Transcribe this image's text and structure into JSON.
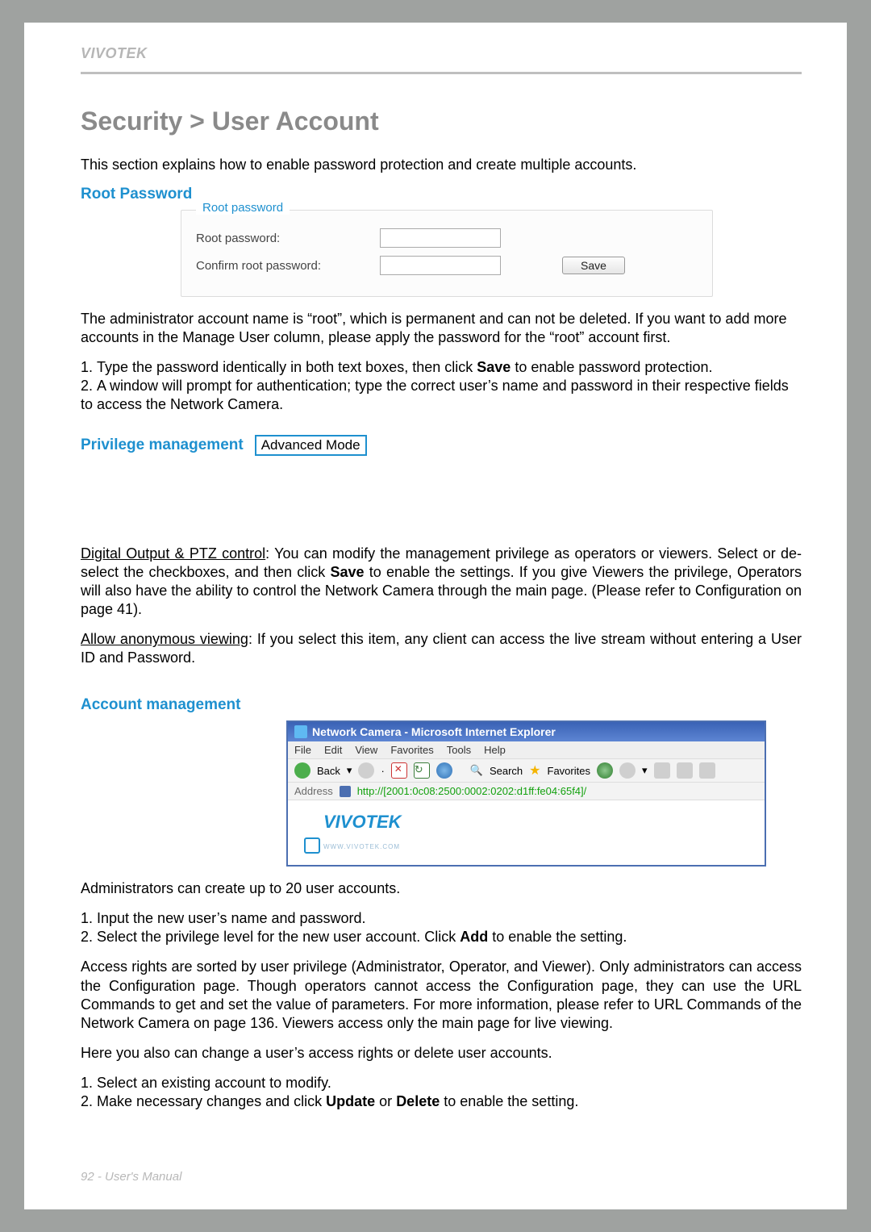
{
  "brand": "VIVOTEK",
  "page_title": "Security > User Account",
  "intro": "This section explains how to enable password protection and create multiple accounts.",
  "root_password": {
    "heading": "Root Password",
    "legend": "Root password",
    "label_pw": "Root password:",
    "label_confirm": "Confirm root password:",
    "save": "Save"
  },
  "admin_text_1": "The administrator account name is “root”, which is permanent and can not be deleted. If you want to add more accounts in the Manage User column, please apply the password for the “root” account first.",
  "admin_list": [
    "Type the password identically in both text boxes, then click ",
    "A window will prompt for authentication; type the correct user’s name and password in their respective fields to access the Network Camera."
  ],
  "admin_list_bold": "Save",
  "admin_list_tail": " to enable password protection.",
  "privilege": {
    "heading": "Privilege management",
    "badge": "Advanced Mode"
  },
  "digital_output": {
    "lead": "Digital Output & PTZ control",
    "body": ": You can modify the management privilege as operators or viewers. Select or de-select the checkboxes, and then click ",
    "bold": "Save",
    "tail": " to enable the settings. If you give Viewers the privilege, Operators will also have the ability to control the Network Camera through the main page. (Please refer to Configuration on page 41)."
  },
  "anon": {
    "lead": "Allow anonymous viewing",
    "body": ": If you select this item, any client can access the live stream without entering a User ID and Password."
  },
  "account_heading": "Account management",
  "ie": {
    "title": "Network Camera - Microsoft Internet Explorer",
    "menu": [
      "File",
      "Edit",
      "View",
      "Favorites",
      "Tools",
      "Help"
    ],
    "back": "Back",
    "search": "Search",
    "favorites": "Favorites",
    "address_label": "Address",
    "url": "http://[2001:0c08:2500:0002:0202:d1ff:fe04:65f4]/",
    "logo_text": "VIVOTEK",
    "logo_sub": "WWW.VIVOTEK.COM"
  },
  "acct_text_1": "Administrators can create up to 20 user accounts.",
  "acct_list": [
    "Input the new user’s name and password.",
    "Select the privilege level for the new user account. Click "
  ],
  "acct_list_bold": "Add",
  "acct_list_tail": " to enable the setting.",
  "access_rights": "Access rights are sorted by user privilege (Administrator, Operator, and Viewer). Only administrators can access the Configuration page. Though operators cannot access the Configuration page, they can use the URL Commands to get and set the value of parameters. For more information, please refer to URL Commands of the Network Camera on page 136. Viewers access only the main page for live viewing.",
  "change_intro": "Here you also can change a user’s access rights or delete user accounts.",
  "change_list": [
    "Select an existing account to modify.",
    "Make necessary changes and click "
  ],
  "change_bold1": "Update",
  "change_or": " or ",
  "change_bold2": "Delete",
  "change_tail": " to enable the setting.",
  "footer": "92 - User's Manual"
}
